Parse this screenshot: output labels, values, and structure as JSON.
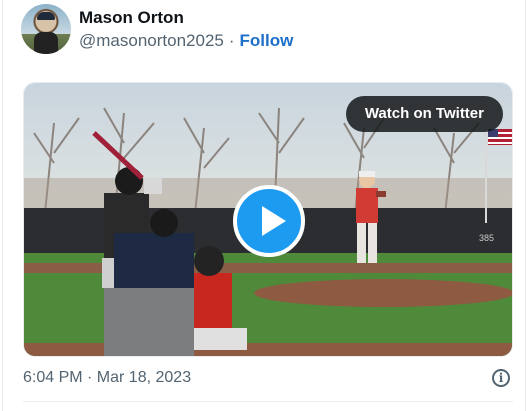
{
  "author": {
    "name": "Mason Orton",
    "handle": "@masonorton2025",
    "separator": "·",
    "follow_label": "Follow"
  },
  "media": {
    "watch_label": "Watch on Twitter",
    "icon": "play-icon",
    "scoreboard_text": "385"
  },
  "footer": {
    "timestamp": "6:04 PM · Mar 18, 2023",
    "info_icon": "info-icon",
    "info_glyph": "i"
  },
  "colors": {
    "follow": "#1d6fc9",
    "play_button": "#1d9bf0",
    "muted_text": "#536471"
  }
}
